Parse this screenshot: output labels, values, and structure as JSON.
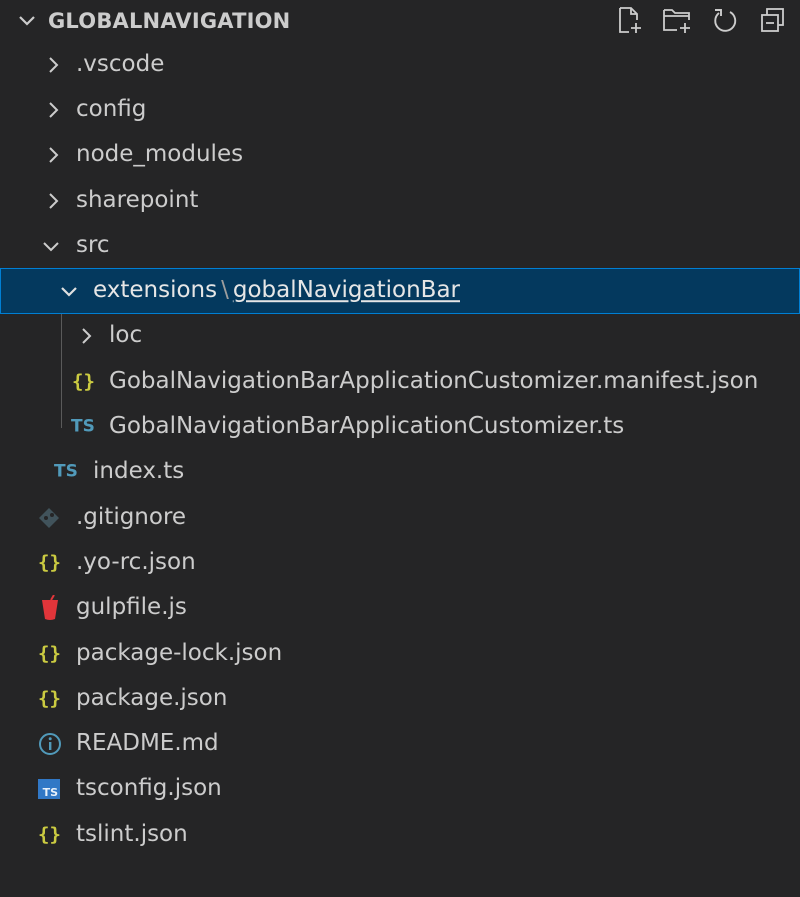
{
  "explorer": {
    "title": "GLOBALNAVIGATION",
    "actions": [
      {
        "name": "new-file",
        "icon": "new-file-icon"
      },
      {
        "name": "new-folder",
        "icon": "new-folder-icon"
      },
      {
        "name": "refresh",
        "icon": "refresh-icon"
      },
      {
        "name": "collapse-all",
        "icon": "collapse-all-icon"
      }
    ]
  },
  "tree": {
    "items": [
      {
        "label": ".vscode",
        "type": "folder",
        "expanded": false
      },
      {
        "label": "config",
        "type": "folder",
        "expanded": false
      },
      {
        "label": "node_modules",
        "type": "folder",
        "expanded": false
      },
      {
        "label": "sharepoint",
        "type": "folder",
        "expanded": false
      },
      {
        "label": "src",
        "type": "folder",
        "expanded": true
      },
      {
        "label_prefix": "extensions",
        "separator": "\\",
        "label_last": "gobalNavigationBar",
        "type": "folder",
        "expanded": true,
        "selected": true
      },
      {
        "label": "loc",
        "type": "folder",
        "expanded": false
      },
      {
        "label": "GobalNavigationBarApplicationCustomizer.manifest.json",
        "type": "json",
        "icon_text": "{}"
      },
      {
        "label": "GobalNavigationBarApplicationCustomizer.ts",
        "type": "ts",
        "icon_text": "TS"
      },
      {
        "label": "index.ts",
        "type": "ts",
        "icon_text": "TS"
      },
      {
        "label": ".gitignore",
        "type": "git"
      },
      {
        "label": ".yo-rc.json",
        "type": "json",
        "icon_text": "{}"
      },
      {
        "label": "gulpfile.js",
        "type": "gulp"
      },
      {
        "label": "package-lock.json",
        "type": "json",
        "icon_text": "{}"
      },
      {
        "label": "package.json",
        "type": "json",
        "icon_text": "{}"
      },
      {
        "label": "README.md",
        "type": "info"
      },
      {
        "label": "tsconfig.json",
        "type": "tsconfig",
        "icon_text": "TS"
      },
      {
        "label": "tslint.json",
        "type": "json",
        "icon_text": "{}"
      }
    ]
  },
  "colors": {
    "background": "#252526",
    "selection": "#04395e",
    "selection_border": "#007fd4",
    "json": "#cbcb41",
    "ts": "#519aba",
    "gulp": "#e2353a"
  }
}
